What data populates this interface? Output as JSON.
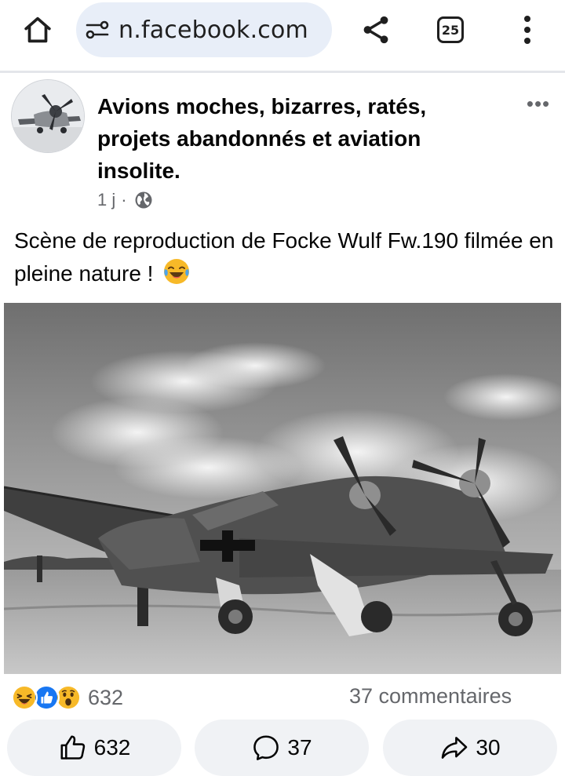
{
  "browser": {
    "url": "n.facebook.com",
    "tab_count": "25",
    "icons": [
      "home-icon",
      "site-settings-icon",
      "share-icon",
      "tabs-icon",
      "more-vert-icon"
    ]
  },
  "post": {
    "group_name": "Avions moches,  bizarres, ratés, projets abandonnés et aviation insolite.",
    "time": "1 j",
    "separator": "·",
    "audience_icon": "globe-icon",
    "more_label": "•••",
    "caption": "Scène de reproduction de Focke Wulf Fw.190 filmée en pleine nature !",
    "caption_emoji": "laughing-tears-emoji"
  },
  "stats": {
    "reaction_icons": [
      "haha-reaction",
      "like-reaction",
      "wow-reaction"
    ],
    "reaction_count": "632",
    "comments": "37 commentaires"
  },
  "actions": {
    "like_count": "632",
    "comment_count": "37",
    "share_count": "30"
  },
  "colors": {
    "facebook_blue": "#1877f2",
    "reaction_yellow": "#f7b928",
    "muted_text": "#65676b",
    "button_bg": "#f0f2f5",
    "url_pill_bg": "#e8eef8"
  }
}
